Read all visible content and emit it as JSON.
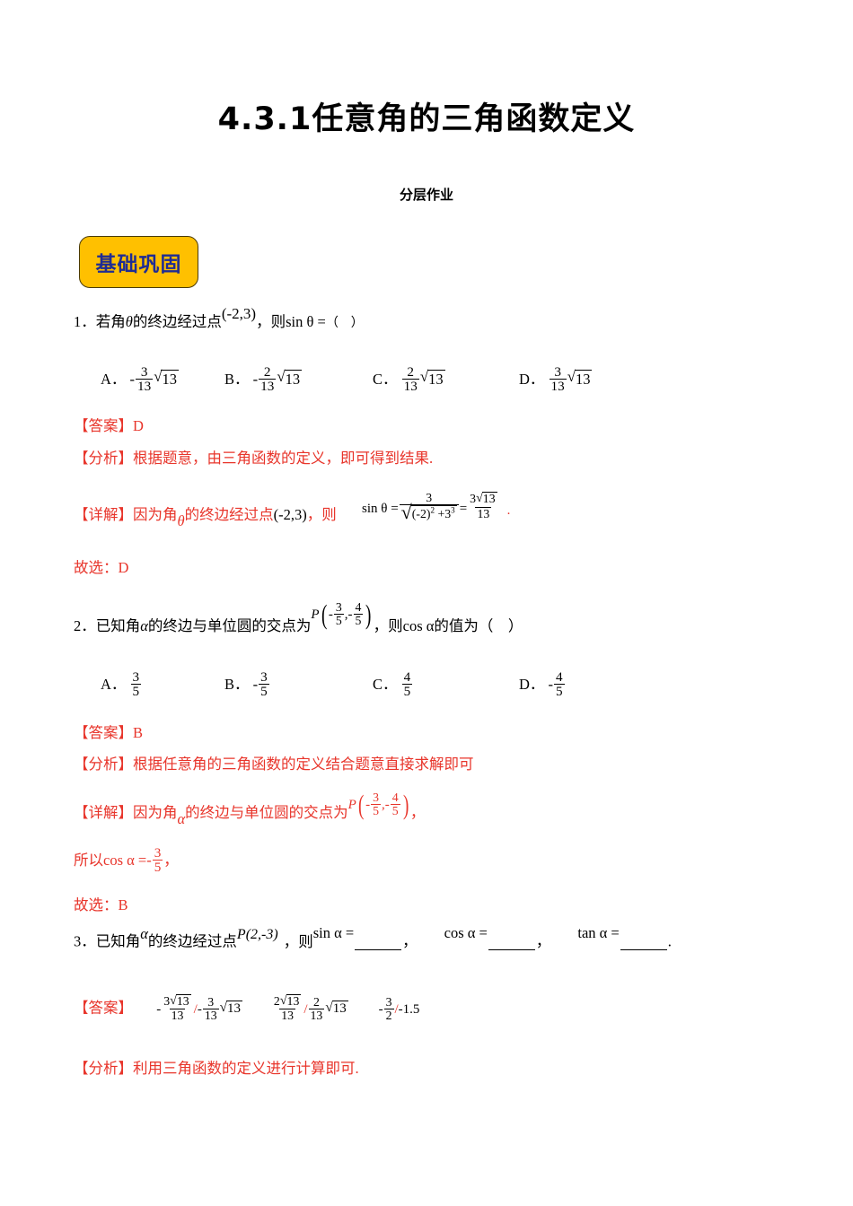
{
  "document": {
    "title": "4.3.1任意角的三角函数定义",
    "subtitle": "分层作业"
  },
  "section": {
    "badge_label": "基础巩固",
    "badge_fill": "#FFC000",
    "badge_text_color": "#1F2C94"
  },
  "colors": {
    "answer_red": "#E8352B",
    "body_black": "#000000"
  },
  "questions": [
    {
      "number": "1．",
      "stem_prefix": "若角",
      "stem_var": "θ",
      "stem_mid": "的终边经过点",
      "stem_point": "(-2,3)",
      "stem_comma": "，则",
      "stem_expr": "sin θ =",
      "stem_choicemark": "（　）",
      "options": [
        {
          "letter": "A．",
          "sign": "-",
          "num": "3",
          "den": "13",
          "radicand": "13"
        },
        {
          "letter": "B．",
          "sign": "-",
          "num": "2",
          "den": "13",
          "radicand": "13"
        },
        {
          "letter": "C．",
          "sign": "",
          "num": "2",
          "den": "13",
          "radicand": "13"
        },
        {
          "letter": "D．",
          "sign": "",
          "num": "3",
          "den": "13",
          "radicand": "13"
        }
      ],
      "answer_label": "【答案】",
      "answer_value": "D",
      "analysis_label": "【分析】",
      "analysis_text": "根据题意，由三角函数的定义，即可得到结果.",
      "detail_label": "【详解】",
      "detail_text_a": "因为角",
      "detail_var": "θ",
      "detail_text_b": "的终边经过点",
      "detail_point": "(-2,3)",
      "detail_text_c": "，则",
      "detail_formula": {
        "lhs": "sin θ =",
        "frac1_num": "3",
        "frac1_den_sqrt": "(-2)² +3³",
        "eq": "=",
        "frac2_num": "3√13",
        "frac2_den": "13",
        "period": "."
      },
      "choose_label": "故选：",
      "choose_value": "D"
    },
    {
      "number": "2．",
      "stem_prefix": "已知角",
      "stem_var": "α",
      "stem_mid": "的终边与单位圆的交点为",
      "stem_point_label": "P",
      "stem_point_x_num": "3",
      "stem_point_x_den": "5",
      "stem_point_y_num": "4",
      "stem_point_y_den": "5",
      "stem_comma": "，则",
      "stem_expr": "cos α",
      "stem_tail": "的值为（　）",
      "options": [
        {
          "letter": "A．",
          "sign": "",
          "num": "3",
          "den": "5"
        },
        {
          "letter": "B．",
          "sign": "-",
          "num": "3",
          "den": "5"
        },
        {
          "letter": "C．",
          "sign": "",
          "num": "4",
          "den": "5"
        },
        {
          "letter": "D．",
          "sign": "-",
          "num": "4",
          "den": "5"
        }
      ],
      "answer_label": "【答案】",
      "answer_value": "B",
      "analysis_label": "【分析】",
      "analysis_text": "根据任意角的三角函数的定义结合题意直接求解即可",
      "detail_label": "【详解】",
      "detail_text_a": "因为角",
      "detail_var": "α",
      "detail_text_b": "的终边与单位圆的交点为",
      "detail_point_label": "P",
      "detail_tail_comma": "，",
      "detail_line2_prefix": "所以",
      "detail_line2_expr": "cos α =-",
      "detail_line2_num": "3",
      "detail_line2_den": "5",
      "detail_line2_comma": "，",
      "choose_label": "故选：",
      "choose_value": "B"
    },
    {
      "number": "3．",
      "stem_prefix": "已知角",
      "stem_var": "α",
      "stem_mid": "的终边经过点",
      "stem_point": "P(2,-3)",
      "stem_comma": "，则",
      "expr1": "sin α =",
      "expr2": "cos α =",
      "expr3": "tan α =",
      "sep_comma": "，",
      "period": ".",
      "answer_label": "【答案】",
      "answer_parts": [
        {
          "sign": "-",
          "num": "3√13",
          "den": "13",
          "slash": "/",
          "alt_sign": "-",
          "alt_num": "3",
          "alt_den": "13",
          "alt_radicand": "13"
        },
        {
          "sign": "",
          "num": "2√13",
          "den": "13",
          "slash": "/",
          "alt_sign": "",
          "alt_num": "2",
          "alt_den": "13",
          "alt_radicand": "13"
        },
        {
          "sign": "-",
          "num": "3",
          "den": "2",
          "slash": "/",
          "alt_text": "-1.5"
        }
      ],
      "analysis_label": "【分析】",
      "analysis_text": "利用三角函数的定义进行计算即可."
    }
  ]
}
